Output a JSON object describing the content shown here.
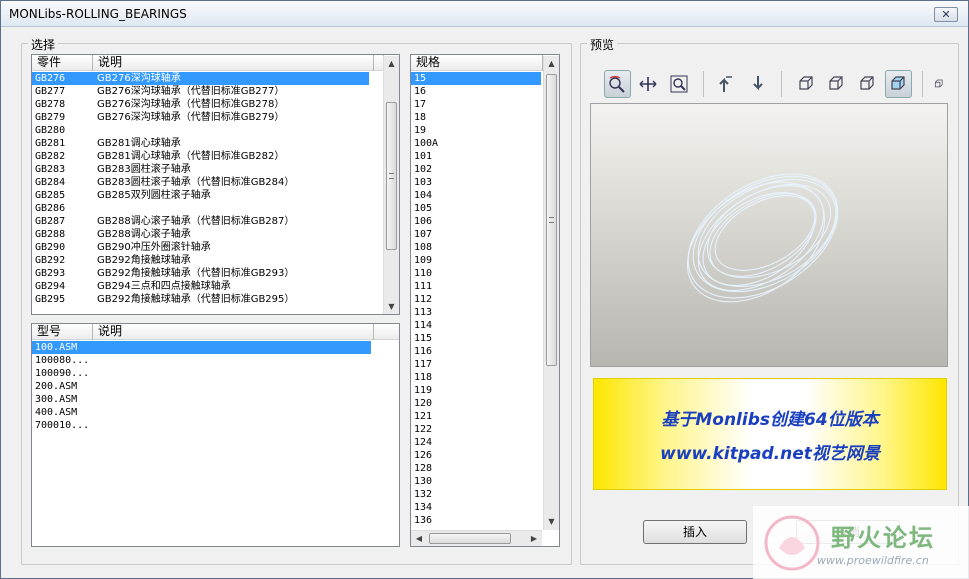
{
  "window": {
    "title": "MONLibs-ROLLING_BEARINGS",
    "close_label": "✕"
  },
  "left_group": {
    "legend": "选择"
  },
  "right_group": {
    "legend": "预览"
  },
  "parts_list": {
    "columns": [
      "零件",
      "说明"
    ],
    "rows": [
      {
        "code": "GB276",
        "desc": "GB276深沟球轴承",
        "selected": true
      },
      {
        "code": "GB277",
        "desc": "GB276深沟球轴承（代替旧标准GB277）"
      },
      {
        "code": "GB278",
        "desc": "GB276深沟球轴承（代替旧标准GB278）"
      },
      {
        "code": "GB279",
        "desc": "GB276深沟球轴承（代替旧标准GB279）"
      },
      {
        "code": "GB280",
        "desc": ""
      },
      {
        "code": "GB281",
        "desc": "GB281调心球轴承"
      },
      {
        "code": "GB282",
        "desc": "GB281调心球轴承（代替旧标准GB282）"
      },
      {
        "code": "GB283",
        "desc": "GB283圆柱滚子轴承"
      },
      {
        "code": "GB284",
        "desc": "GB283圆柱滚子轴承（代替旧标准GB284）"
      },
      {
        "code": "GB285",
        "desc": "GB285双列圆柱滚子轴承"
      },
      {
        "code": "GB286",
        "desc": ""
      },
      {
        "code": "GB287",
        "desc": "GB288调心滚子轴承（代替旧标准GB287）"
      },
      {
        "code": "GB288",
        "desc": "GB288调心滚子轴承"
      },
      {
        "code": "GB290",
        "desc": "GB290冲压外圈滚针轴承"
      },
      {
        "code": "GB292",
        "desc": "GB292角接触球轴承"
      },
      {
        "code": "GB293",
        "desc": "GB292角接触球轴承（代替旧标准GB293）"
      },
      {
        "code": "GB294",
        "desc": "GB294三点和四点接触球轴承"
      },
      {
        "code": "GB295",
        "desc": "GB292角接触球轴承（代替旧标准GB295）"
      }
    ]
  },
  "model_list": {
    "columns": [
      "型号",
      "说明"
    ],
    "rows": [
      {
        "code": "100.ASM",
        "selected": true
      },
      {
        "code": "100080..."
      },
      {
        "code": "100090..."
      },
      {
        "code": "200.ASM"
      },
      {
        "code": "300.ASM"
      },
      {
        "code": "400.ASM"
      },
      {
        "code": "700010..."
      }
    ]
  },
  "spec_list": {
    "columns": [
      "规格"
    ],
    "rows": [
      "15",
      "16",
      "17",
      "18",
      "19",
      "100A",
      "101",
      "102",
      "103",
      "104",
      "105",
      "106",
      "107",
      "108",
      "109",
      "110",
      "111",
      "112",
      "113",
      "114",
      "115",
      "116",
      "117",
      "118",
      "119",
      "120",
      "121",
      "122",
      "124",
      "126",
      "128",
      "130",
      "132",
      "134",
      "136"
    ],
    "selected_index": 0
  },
  "toolbar": {
    "icons": [
      "spin-icon",
      "pan-icon",
      "zoom-window-icon",
      "rotate-left-icon",
      "rotate-right-icon",
      "view-front-icon",
      "view-iso-icon",
      "view-side-icon",
      "shaded-cube-icon",
      "view-extra-icon"
    ]
  },
  "banner": {
    "line1": "基于Monlibs创建64位版本",
    "line2": "www.kitpad.net视艺网景"
  },
  "buttons": {
    "insert": "插入",
    "cancel": "取消"
  },
  "watermark": {
    "name": "野火论坛",
    "url": "www.proewildfire.cn"
  },
  "colors": {
    "selection": "#3399ff",
    "banner_text": "#1a3fbf"
  }
}
